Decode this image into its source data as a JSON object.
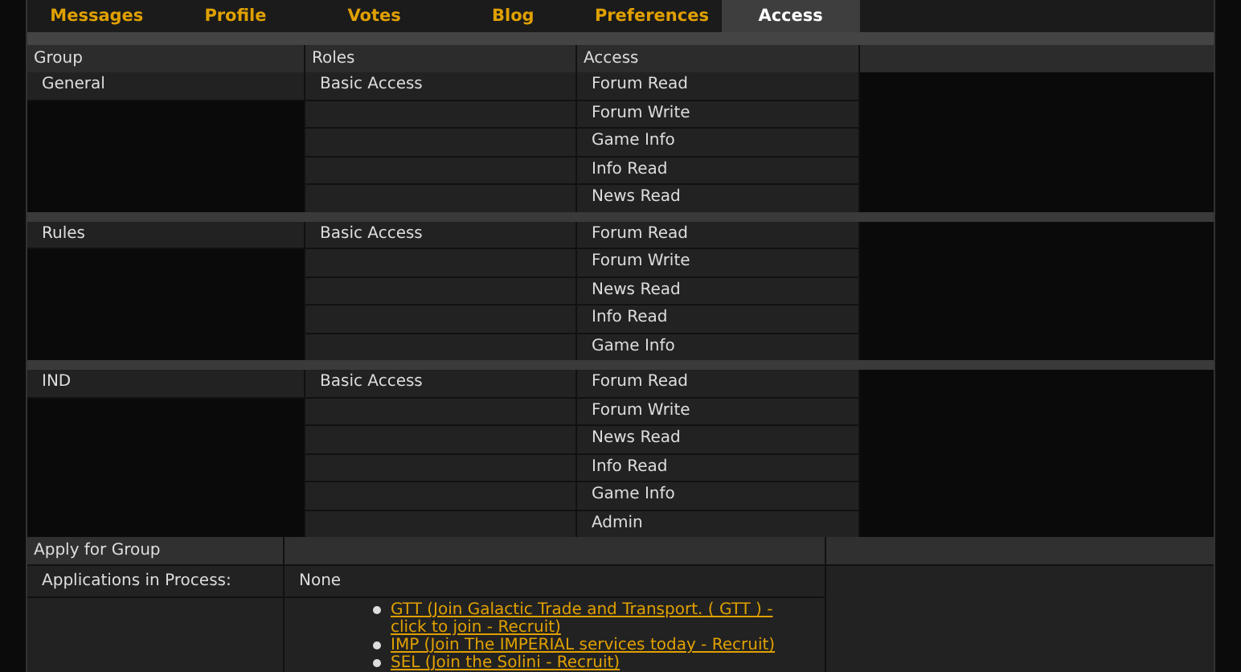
{
  "tabs": [
    {
      "label": "Messages",
      "selected": false
    },
    {
      "label": "Profile",
      "selected": false
    },
    {
      "label": "Votes",
      "selected": false
    },
    {
      "label": "Blog",
      "selected": false
    },
    {
      "label": "Preferences",
      "selected": false
    },
    {
      "label": "Access",
      "selected": true
    }
  ],
  "table": {
    "columns": [
      "Group",
      "Roles",
      "Access"
    ],
    "groups": [
      {
        "group": "General",
        "role": "Basic Access",
        "access": [
          "Forum Read",
          "Forum Write",
          "Game Info",
          "Info Read",
          "News Read"
        ]
      },
      {
        "group": "Rules",
        "role": "Basic Access",
        "access": [
          "Forum Read",
          "Forum Write",
          "News Read",
          "Info Read",
          "Game Info"
        ]
      },
      {
        "group": "IND",
        "role": "Basic Access",
        "access": [
          "Forum Read",
          "Forum Write",
          "News Read",
          "Info Read",
          "Game Info",
          "Admin"
        ]
      }
    ]
  },
  "apply": {
    "title": "Apply for Group",
    "applications_label": "Applications in Process:",
    "applications_value": "None",
    "links": [
      "GTT (Join Galactic Trade and Transport. ( GTT ) - click to join - Recruit)",
      "IMP (Join The IMPERIAL services today - Recruit)",
      "SEL (Join the Solini - Recruit)"
    ]
  }
}
